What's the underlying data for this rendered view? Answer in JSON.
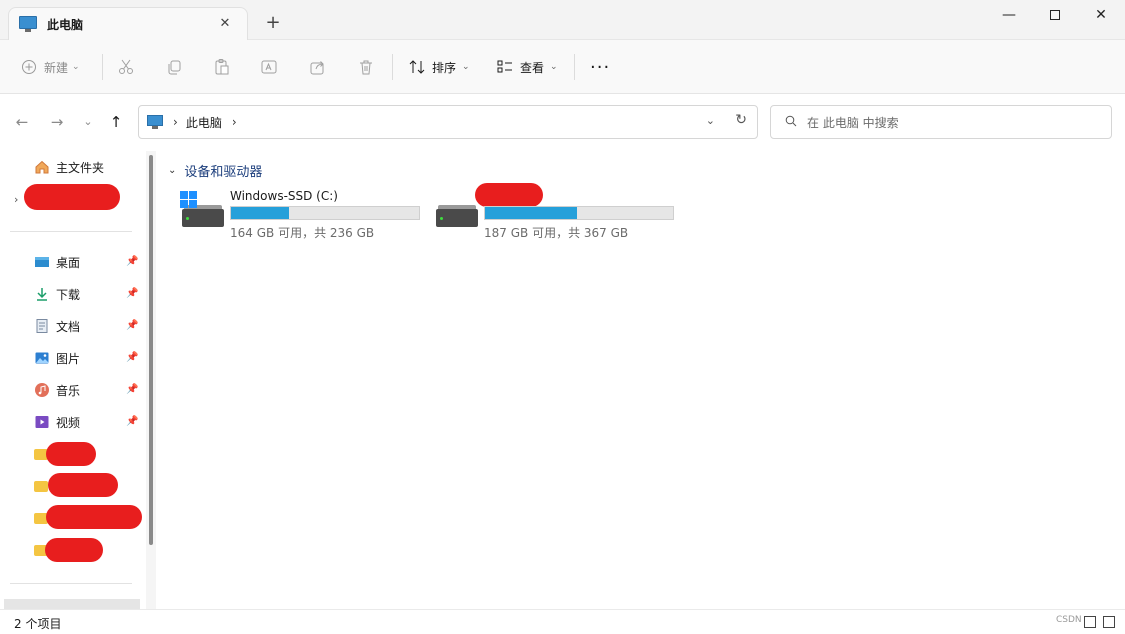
{
  "window": {
    "tab_title": "此电脑",
    "tab_close": "✕",
    "tab_add": "+",
    "minimize": "—",
    "close": "✕"
  },
  "toolbar": {
    "new_label": "新建",
    "sort_label": "排序",
    "view_label": "查看",
    "more_label": "···"
  },
  "address": {
    "crumbs": [
      "此电脑"
    ],
    "search_placeholder": "在 此电脑 中搜索"
  },
  "sidebar": {
    "home_label": "主文件夹",
    "items": [
      {
        "label": "桌面",
        "icon": "desktop-icon"
      },
      {
        "label": "下载",
        "icon": "download-icon"
      },
      {
        "label": "文档",
        "icon": "document-icon"
      },
      {
        "label": "图片",
        "icon": "picture-icon"
      },
      {
        "label": "音乐",
        "icon": "music-icon"
      },
      {
        "label": "视频",
        "icon": "video-icon"
      }
    ]
  },
  "content": {
    "group_title": "设备和驱动器",
    "drives": [
      {
        "name": "Windows-SSD (C:)",
        "capacity": "164 GB 可用，共 236 GB",
        "used_fraction": 0.31
      },
      {
        "name": "",
        "capacity": "187 GB 可用，共 367 GB",
        "used_fraction": 0.49
      }
    ]
  },
  "status": {
    "item_count": "2 个项目",
    "watermark": "CSDN"
  },
  "colors": {
    "accent": "#26a0da",
    "redaction": "#e81e1e",
    "folder": "#f4c542"
  }
}
